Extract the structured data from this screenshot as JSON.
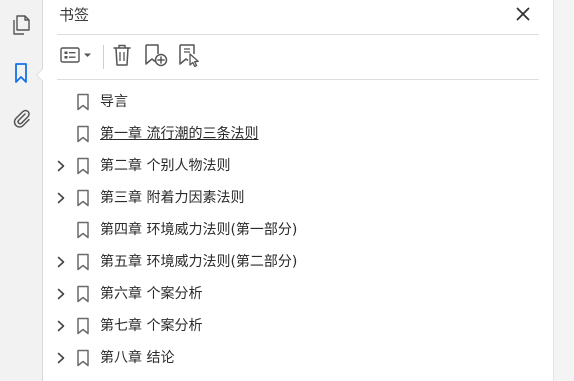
{
  "panel": {
    "title": "书签"
  },
  "rail": {
    "items": [
      {
        "name": "pages",
        "icon": "page-thumbnails-icon",
        "active": false
      },
      {
        "name": "bookmarks",
        "icon": "bookmark-icon",
        "active": true
      },
      {
        "name": "attachments",
        "icon": "paperclip-icon",
        "active": false
      }
    ],
    "active_color": "#1473e6"
  },
  "toolbar": {
    "options_icon": "options-menu-icon",
    "delete_icon": "trash-icon",
    "new_icon": "new-bookmark-icon",
    "replace_icon": "bookmark-from-selection-icon"
  },
  "bookmarks": [
    {
      "label": "导言",
      "expandable": false,
      "underline": false
    },
    {
      "label": "第一章 流行潮的三条法则",
      "expandable": false,
      "underline": true
    },
    {
      "label": "第二章 个别人物法则",
      "expandable": true,
      "underline": false
    },
    {
      "label": "第三章 附着力因素法则",
      "expandable": true,
      "underline": false
    },
    {
      "label": "第四章 环境威力法则(第一部分)",
      "expandable": false,
      "underline": false
    },
    {
      "label": "第五章 环境威力法则(第二部分)",
      "expandable": true,
      "underline": false
    },
    {
      "label": "第六章 个案分析",
      "expandable": true,
      "underline": false
    },
    {
      "label": "第七章 个案分析",
      "expandable": true,
      "underline": false
    },
    {
      "label": "第八章 结论",
      "expandable": true,
      "underline": false
    }
  ]
}
